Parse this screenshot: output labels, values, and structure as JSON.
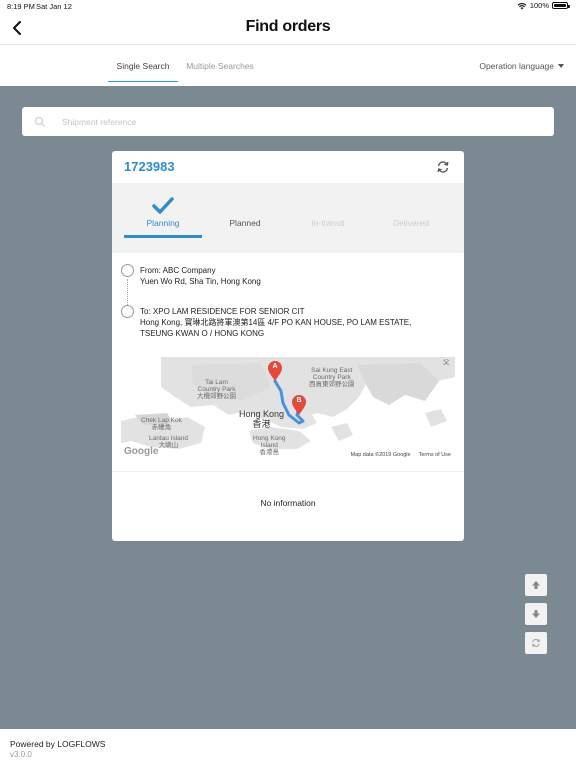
{
  "status_bar": {
    "time": "8:19 PM",
    "date": "Sat Jan 12",
    "battery": "100%"
  },
  "nav": {
    "title": "Find orders"
  },
  "tabs": {
    "single": "Single Search",
    "multiple": "Multiple Searches",
    "language": "Operation language"
  },
  "search": {
    "placeholder": "Shipment reference"
  },
  "order": {
    "number": "1723983",
    "steps": [
      "Planning",
      "Planned",
      "In-transit",
      "Delivered"
    ],
    "current_step": "Planning",
    "from": {
      "line1": "From: ABC Company",
      "line2": "Yuen Wo Rd, Sha Tin, Hong Kong"
    },
    "to": {
      "line1": "To: XPO LAM RESIDENCE FOR SENIOR CIT",
      "line2": "Hong Kong, 寶琳北路將軍澳第14區 4/F PO KAN HOUSE, PO LAM ESTATE,",
      "line3": "TSEUNG KWAN O / HONG KONG"
    },
    "map": {
      "labels": {
        "tai_lam": "Tai Lam\nCountry Park\n大欖郊野公園",
        "sai_kung": "Sai Kung East\nCountry Park\n西貢東郊野公園",
        "chek_lap_kok": "Chek Lap Kok\n赤鱲角",
        "lantau": "Lantau Island\n大嶼山",
        "hong_kong": "Hong Kong\n香港",
        "hk_island": "Hong Kong\nIsland\n香港島",
        "marker_a": "A",
        "marker_b": "B"
      },
      "google": "Google",
      "map_data": "Map data ©2019 Google",
      "terms": "Terms of Use",
      "corner_glyph": "父"
    },
    "info": "No information"
  },
  "footer": {
    "powered": "Powered by LOGFLOWS",
    "version": "v3.0.0"
  },
  "colors": {
    "accent": "#2e8fc8",
    "background": "#7b8993",
    "marker": "#e24a3b"
  }
}
